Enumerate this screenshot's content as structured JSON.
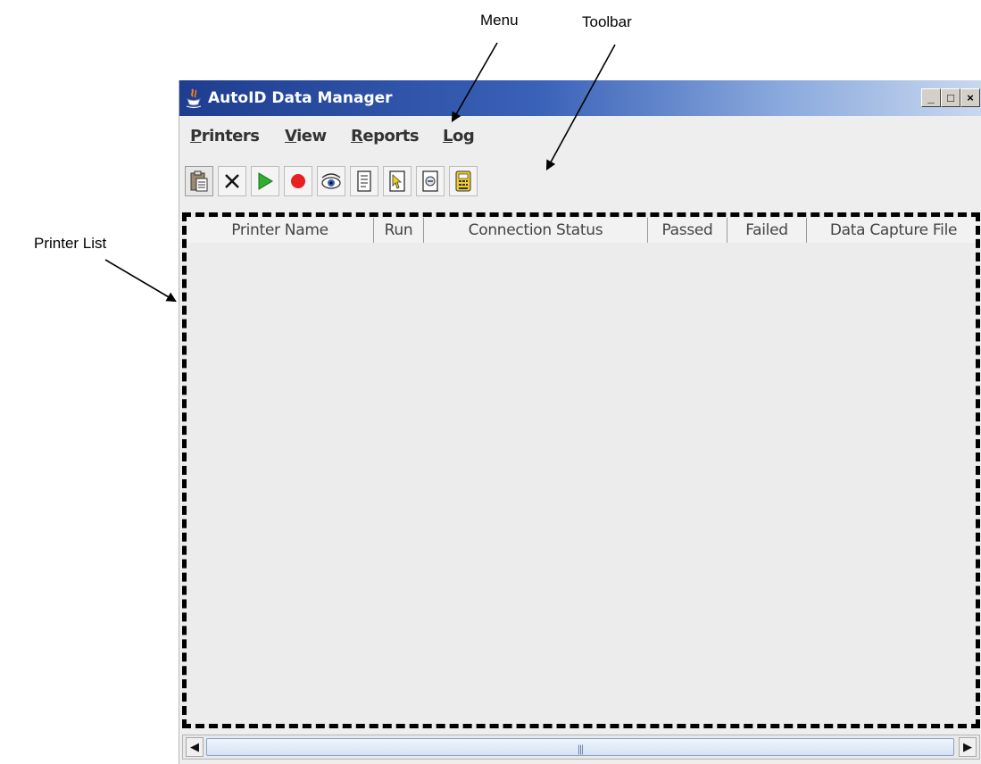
{
  "callouts": {
    "menu": "Menu",
    "toolbar": "Toolbar",
    "printer_list": "Printer List"
  },
  "window": {
    "title": "AutoID Data Manager",
    "controls": {
      "minimize": "_",
      "maximize": "□",
      "close": "×"
    }
  },
  "menu": {
    "items": [
      {
        "label": "Printers"
      },
      {
        "label": "View"
      },
      {
        "label": "Reports"
      },
      {
        "label": "Log"
      }
    ]
  },
  "toolbar": {
    "buttons": [
      {
        "icon": "clipboard-icon"
      },
      {
        "icon": "delete-x-icon"
      },
      {
        "icon": "play-icon"
      },
      {
        "icon": "stop-record-icon"
      },
      {
        "icon": "view-eye-icon"
      },
      {
        "icon": "document-icon"
      },
      {
        "icon": "document-pointer-icon"
      },
      {
        "icon": "document-e-icon"
      },
      {
        "icon": "calculator-icon"
      }
    ]
  },
  "printer_list": {
    "columns": [
      {
        "label": "Printer Name"
      },
      {
        "label": "Run"
      },
      {
        "label": "Connection Status"
      },
      {
        "label": "Passed"
      },
      {
        "label": "Failed"
      },
      {
        "label": "Data Capture File"
      }
    ],
    "rows": []
  },
  "scrollbar": {
    "left_arrow": "◀",
    "right_arrow": "▶",
    "grip": "|||"
  },
  "colors": {
    "title_start": "#1e3d8f",
    "title_end": "#c9d8ef",
    "play": "#2fae2f",
    "stop": "#e82020"
  }
}
